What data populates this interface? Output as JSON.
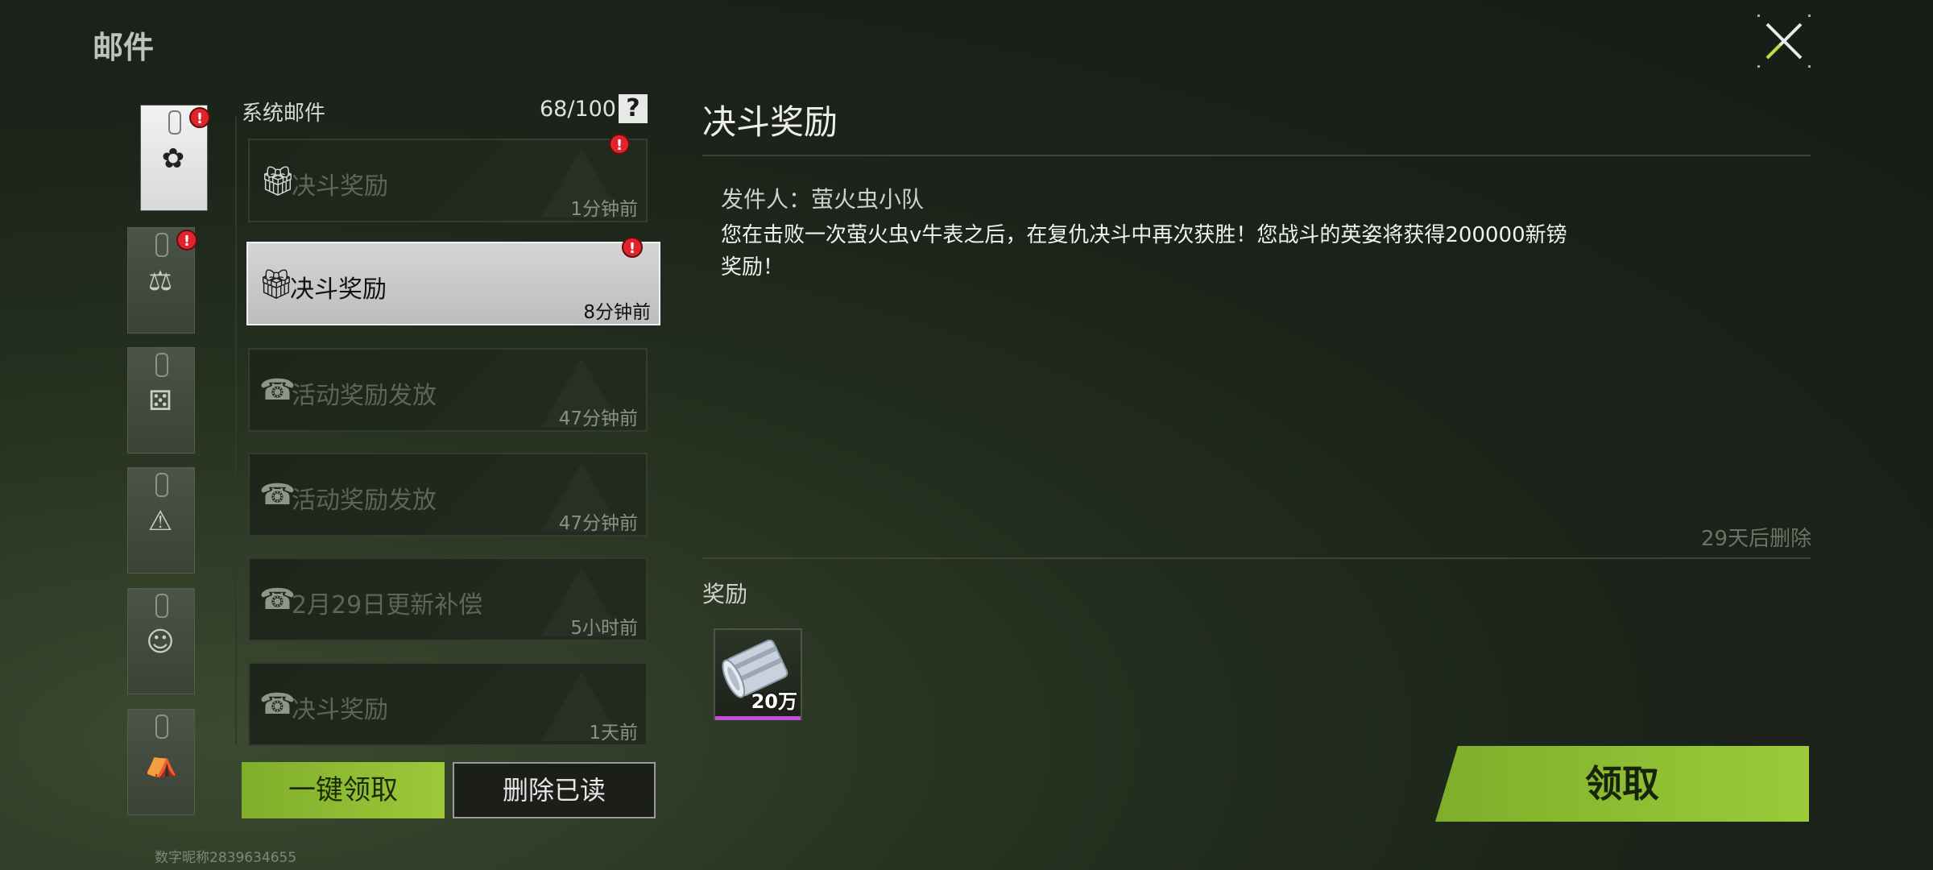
{
  "header": {
    "title": "邮件"
  },
  "categories": [
    {
      "name": "system",
      "icon": "gear-icon",
      "active": true,
      "unread": true
    },
    {
      "name": "auction",
      "icon": "gavel-icon",
      "active": false,
      "unread": true
    },
    {
      "name": "game",
      "icon": "dice-icon",
      "active": false,
      "unread": false
    },
    {
      "name": "warning",
      "icon": "warning-icon",
      "active": false,
      "unread": false
    },
    {
      "name": "friend",
      "icon": "girl-icon",
      "active": false,
      "unread": false
    },
    {
      "name": "gift-bag",
      "icon": "bag-icon",
      "active": false,
      "unread": false
    }
  ],
  "list": {
    "title": "系统邮件",
    "count": "68/100",
    "help": "?",
    "items": [
      {
        "title": "决斗奖励",
        "time": "1分钟前",
        "icon": "gift-icon",
        "state": "unread"
      },
      {
        "title": "决斗奖励",
        "time": "8分钟前",
        "icon": "gift-icon",
        "state": "selected"
      },
      {
        "title": "活动奖励发放",
        "time": "47分钟前",
        "icon": "opened-gift-icon",
        "state": "read"
      },
      {
        "title": "活动奖励发放",
        "time": "47分钟前",
        "icon": "opened-gift-icon",
        "state": "read"
      },
      {
        "title": "2月29日更新补偿",
        "time": "5小时前",
        "icon": "opened-gift-icon",
        "state": "read"
      },
      {
        "title": "决斗奖励",
        "time": "1天前",
        "icon": "opened-gift-icon",
        "state": "read"
      }
    ]
  },
  "buttons": {
    "claim_all": "一键领取",
    "delete_read": "删除已读",
    "claim": "领取"
  },
  "footer": {
    "nickname": "数字昵称2839634655"
  },
  "detail": {
    "title": "决斗奖励",
    "sender": "发件人：萤火虫小队",
    "body": "您在击败一次萤火虫v牛表之后，在复仇决斗中再次获胜！您战斗的英姿将获得200000新镑奖励！",
    "expire": "29天后删除",
    "reward_label": "奖励",
    "reward": {
      "quantity": "20万",
      "icon": "cash-bundle-icon"
    }
  },
  "colors": {
    "accent": "#8fbf30",
    "badge": "#e0242a",
    "rarity": "#c04ed8"
  }
}
